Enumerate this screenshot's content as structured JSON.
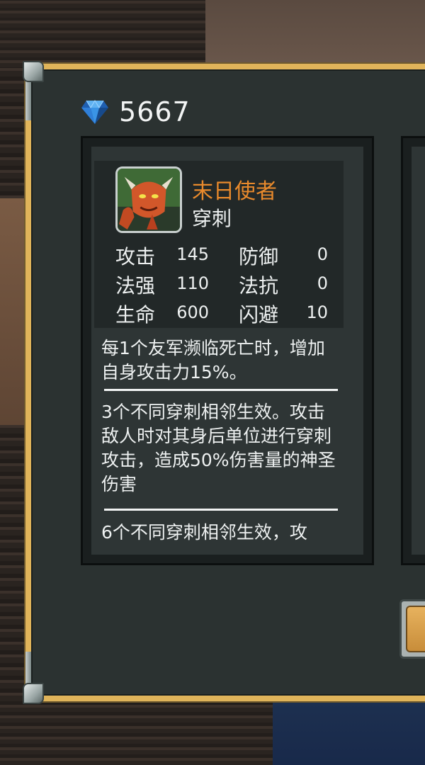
{
  "currency": {
    "icon": "diamond-gem-icon",
    "value": "5667"
  },
  "hero": {
    "name": "末日使者",
    "class": "穿刺",
    "name_color": "#e98a2c",
    "stats": {
      "attack_label": "攻击",
      "attack_value": "145",
      "defense_label": "防御",
      "defense_value": "0",
      "power_label": "法强",
      "power_value": "110",
      "resist_label": "法抗",
      "resist_value": "0",
      "hp_label": "生命",
      "hp_value": "600",
      "dodge_label": "闪避",
      "dodge_value": "10"
    },
    "skill_description": "每1个友军濒临死亡时，增加自身攻击力15%。",
    "synergy_3": "3个不同穿刺相邻生效。攻击敌人时对其身后单位进行穿刺攻击，造成50%伤害量的神圣伤害",
    "synergy_6_partial": "6个不同穿刺相邻生效，攻"
  },
  "colors": {
    "frame_gold": "#e0b45a",
    "panel_dark": "#2b3231",
    "gem_blue": "#2f7fd8",
    "button_orange": "#e7b25e"
  }
}
